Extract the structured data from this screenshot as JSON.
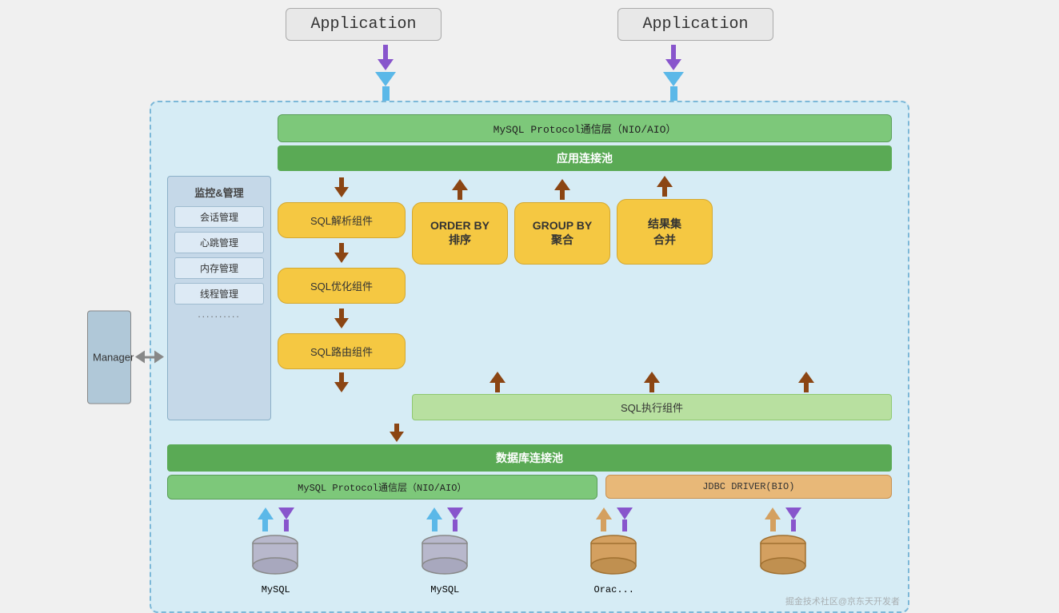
{
  "apps": {
    "left_label": "Application",
    "right_label": "Application"
  },
  "manager": {
    "label": "Manager"
  },
  "monitor": {
    "title": "监控&管理",
    "items": [
      "会话管理",
      "心跳管理",
      "内存管理",
      "线程管理",
      ".........."
    ]
  },
  "layers": {
    "protocol_top": "MySQL Protocol通信层（NIO/AIO）",
    "connection_pool_top": "应用连接池",
    "sql_parse": "SQL解析组件",
    "sql_optimize": "SQL优化组件",
    "sql_route": "SQL路由组件",
    "order_by": "ORDER BY\n排序",
    "group_by": "GROUP BY\n聚合",
    "result_merge": "结果集\n合并",
    "sql_execute": "SQL执行组件",
    "db_pool": "数据库连接池",
    "protocol_bottom": "MySQL Protocol通信层（NIO/AIO）",
    "jdbc_driver": "JDBC DRIVER(BIO)"
  },
  "databases": {
    "mysql1": "MySQL",
    "mysql2": "MySQL",
    "oracle": "Orac...",
    "other": ""
  },
  "watermark": "掘金技术社区@京东天开发者"
}
